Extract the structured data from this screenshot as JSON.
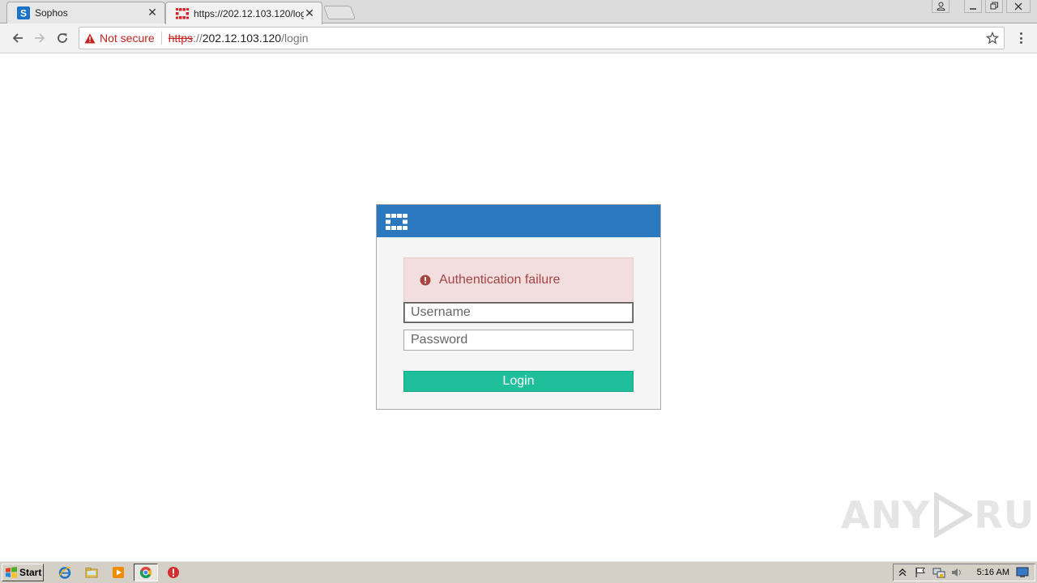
{
  "browser": {
    "tabs": [
      {
        "title": "Sophos",
        "favicon": "sophos-favicon"
      },
      {
        "title": "https://202.12.103.120/login",
        "favicon": "fortinet-favicon",
        "active": true
      }
    ],
    "address_bar": {
      "security_label": "Not secure",
      "url_scheme": "https",
      "url_sep": "://",
      "url_host": "202.12.103.120",
      "url_path": "/login"
    }
  },
  "login": {
    "error_message": "Authentication failure",
    "username_placeholder": "Username",
    "password_placeholder": "Password",
    "login_label": "Login",
    "header_color": "#2b78bf",
    "button_color": "#1fbf9c"
  },
  "watermark": {
    "left": "ANY",
    "right": "RUN"
  },
  "taskbar": {
    "start_label": "Start",
    "clock": "5:16 AM"
  }
}
